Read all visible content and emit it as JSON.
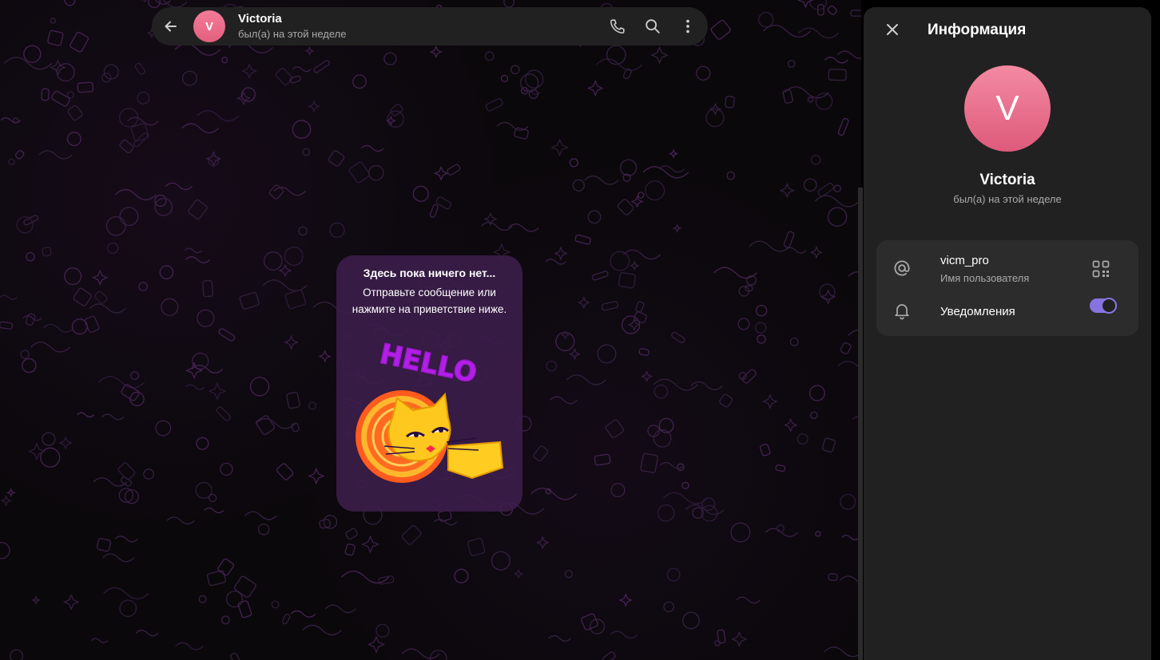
{
  "chat": {
    "name": "Victoria",
    "avatar_letter": "V",
    "status": "был(а) на этой неделе"
  },
  "empty_state": {
    "title": "Здесь пока ничего нет...",
    "text": "Отправьте сообщение или нажмите на приветствие ниже.",
    "sticker_text": "HELLO"
  },
  "info_panel": {
    "title": "Информация",
    "avatar_letter": "V",
    "name": "Victoria",
    "status": "был(а) на этой неделе",
    "username": "vicm_pro",
    "username_label": "Имя пользователя",
    "notifications_label": "Уведомления",
    "notifications_enabled": true
  },
  "colors": {
    "accent": "#8774e1",
    "avatar": "#e8698a",
    "panel_bg": "#212121",
    "card_bg": "#2c2c2c"
  },
  "icons": {
    "back": "arrow-left-icon",
    "call": "phone-icon",
    "search": "search-icon",
    "menu": "more-vertical-icon",
    "close": "close-icon",
    "username": "at-sign-icon",
    "qr": "qr-code-icon",
    "notifications": "bell-icon"
  }
}
